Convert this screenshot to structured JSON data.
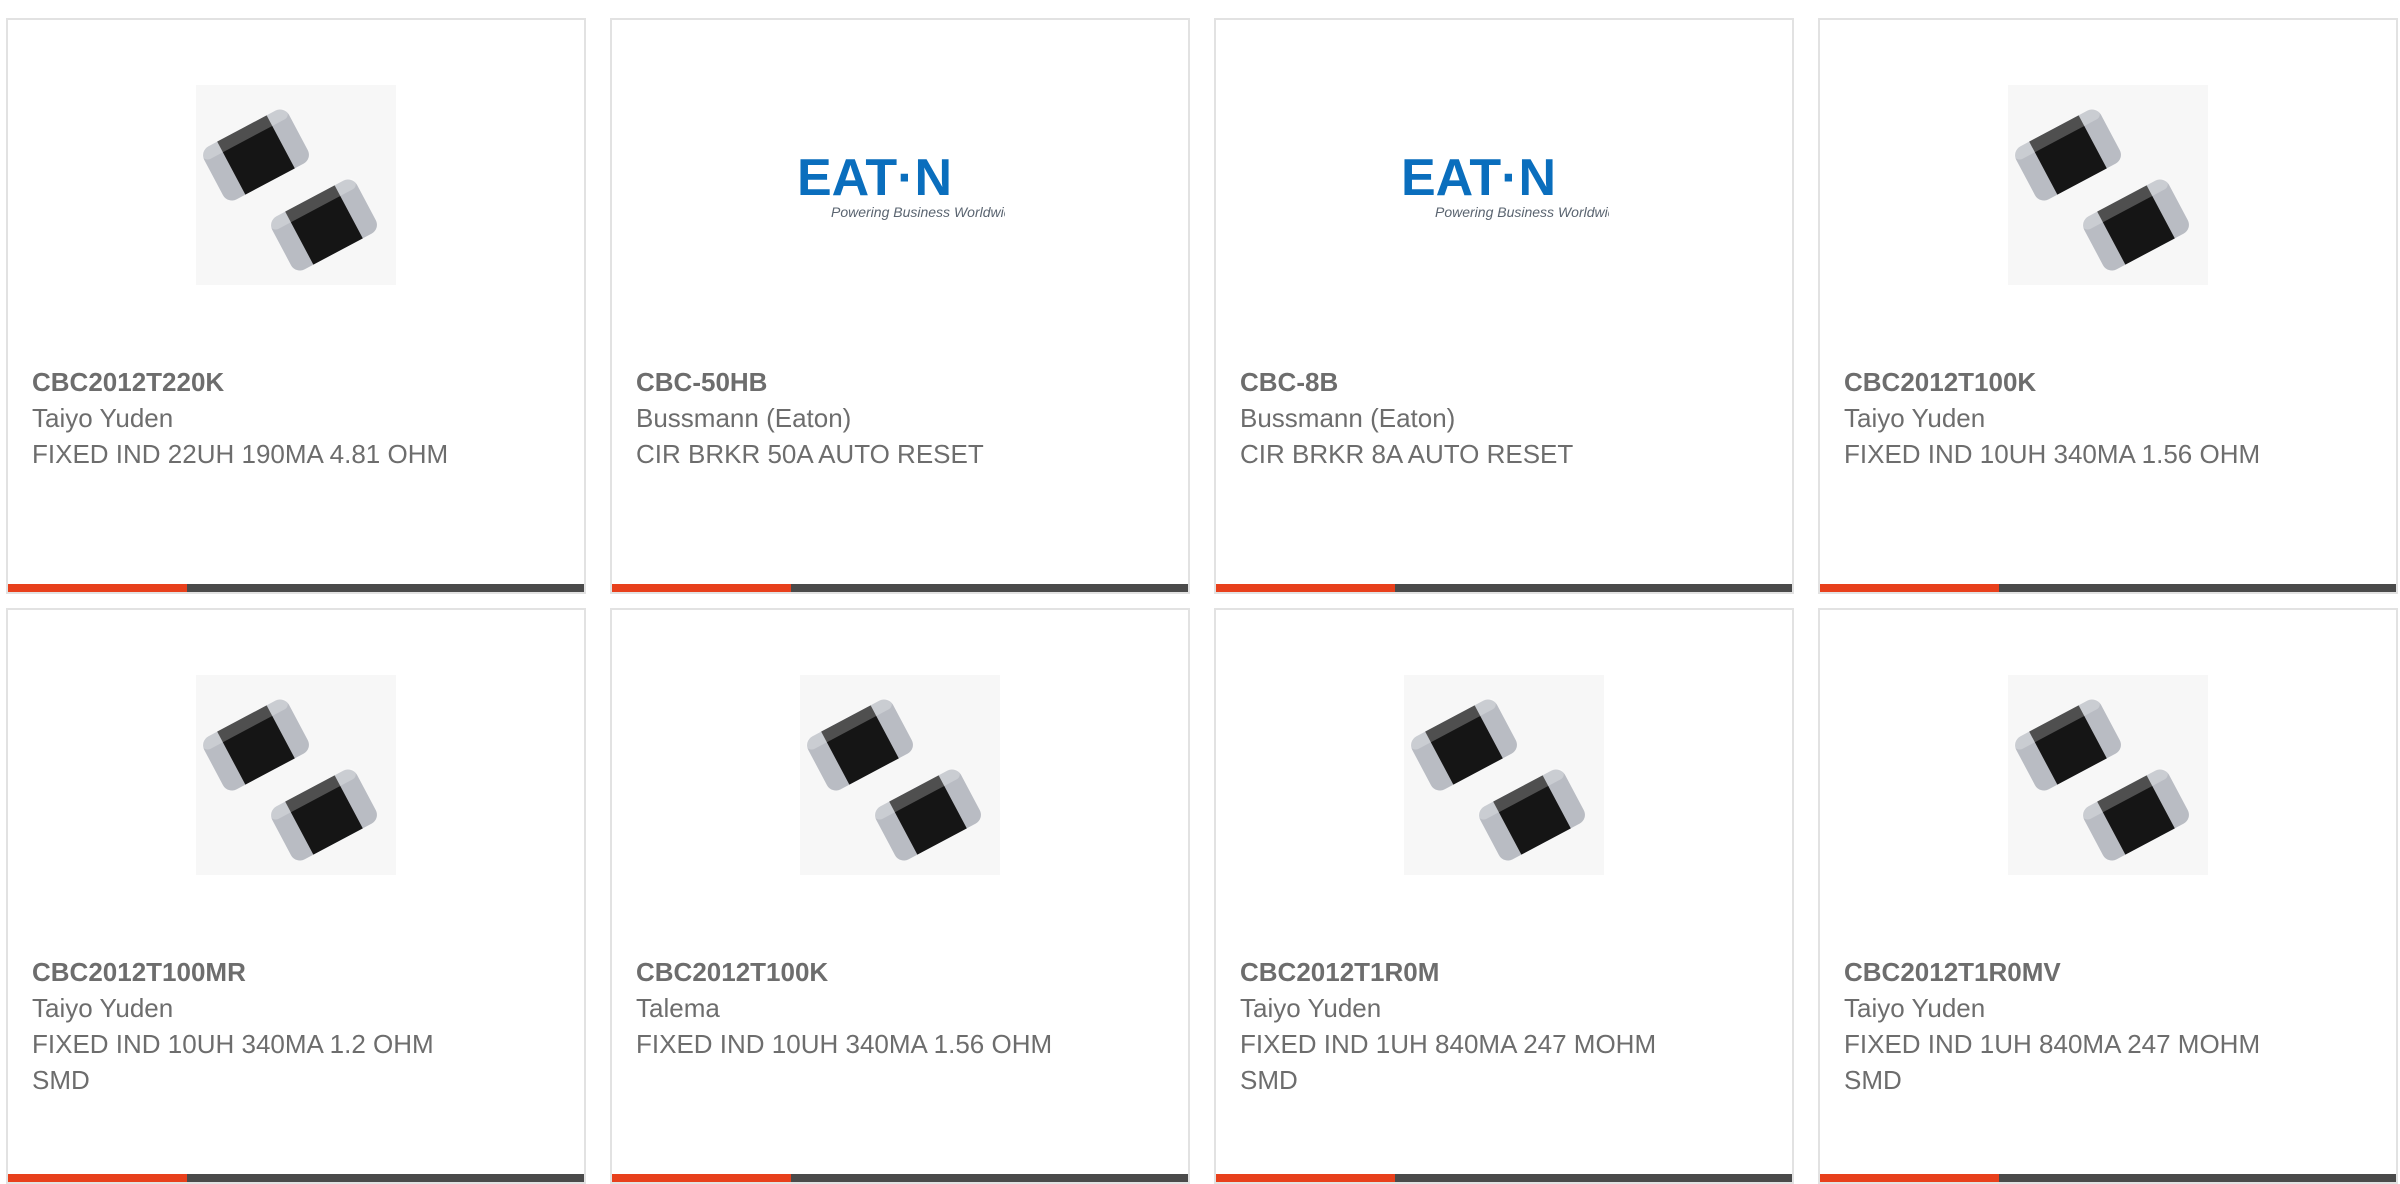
{
  "brand_colors": {
    "accent": "#e8401c",
    "bar_dark": "#4a4a4a",
    "eaton_blue": "#0a6ebd",
    "text_gray": "#6d6d6d"
  },
  "logos": {
    "eaton_wordmark": "EAT·N",
    "eaton_tagline": "Powering Business Worldwide"
  },
  "products": [
    {
      "part": "CBC2012T220K",
      "manufacturer": "Taiyo Yuden",
      "description": "FIXED IND 22UH 190MA 4.81 OHM",
      "image": "smd-inductor-pair",
      "progress": 0.31
    },
    {
      "part": "CBC-50HB",
      "manufacturer": "Bussmann (Eaton)",
      "description": "CIR BRKR 50A AUTO RESET",
      "image": "eaton-logo",
      "progress": 0.31
    },
    {
      "part": "CBC-8B",
      "manufacturer": "Bussmann (Eaton)",
      "description": "CIR BRKR 8A AUTO RESET",
      "image": "eaton-logo",
      "progress": 0.31
    },
    {
      "part": "CBC2012T100K",
      "manufacturer": "Taiyo Yuden",
      "description": "FIXED IND 10UH 340MA 1.56 OHM",
      "image": "smd-inductor-pair",
      "progress": 0.31
    },
    {
      "part": "CBC2012T100MR",
      "manufacturer": "Taiyo Yuden",
      "description": "FIXED IND 10UH 340MA 1.2 OHM SMD",
      "image": "smd-inductor-pair",
      "progress": 0.31
    },
    {
      "part": "CBC2012T100K",
      "manufacturer": "Talema",
      "description": "FIXED IND 10UH 340MA 1.56 OHM",
      "image": "smd-inductor-pair",
      "progress": 0.31
    },
    {
      "part": "CBC2012T1R0M",
      "manufacturer": "Taiyo Yuden",
      "description": "FIXED IND 1UH 840MA 247 MOHM SMD",
      "image": "smd-inductor-pair",
      "progress": 0.31
    },
    {
      "part": "CBC2012T1R0MV",
      "manufacturer": "Taiyo Yuden",
      "description": "FIXED IND 1UH 840MA 247 MOHM SMD",
      "image": "smd-inductor-pair",
      "progress": 0.31
    }
  ]
}
